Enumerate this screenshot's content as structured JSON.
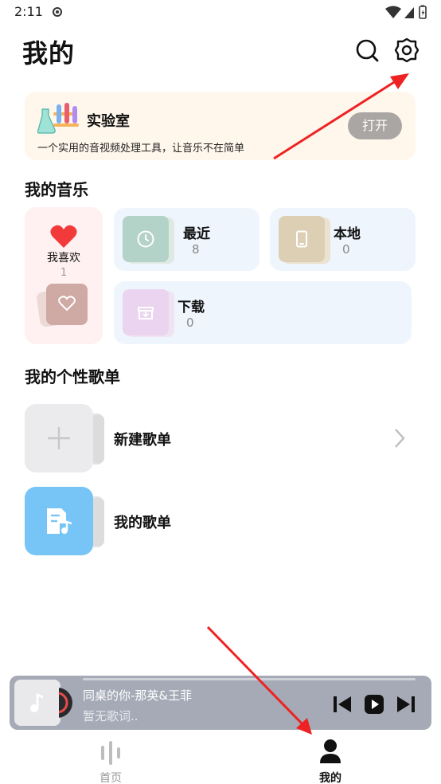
{
  "status_bar": {
    "time": "2:11"
  },
  "header": {
    "title": "我的"
  },
  "lab": {
    "title": "实验室",
    "description": "一个实用的音视频处理工具，让音乐不在简单",
    "open_label": "打开"
  },
  "my_music": {
    "title": "我的音乐",
    "favorites": {
      "label": "我喜欢",
      "count": "1"
    },
    "recent": {
      "label": "最近",
      "count": "8"
    },
    "local": {
      "label": "本地",
      "count": "0"
    },
    "downloads": {
      "label": "下载",
      "count": "0"
    }
  },
  "playlists": {
    "title": "我的个性歌单",
    "items": [
      {
        "label": "新建歌单"
      },
      {
        "label": "我的歌单"
      }
    ]
  },
  "player": {
    "song": "同桌的你-那英&王菲",
    "lyric": "暂无歌词.."
  },
  "bottom_nav": {
    "items": [
      {
        "label": "首页"
      },
      {
        "label": "我的"
      }
    ]
  },
  "colors": {
    "accent_red": "#f23a3a",
    "lab_bg": "#fff7ec",
    "card_bg": "#eef5fd",
    "player_bg": "#a5aab6",
    "annotation_arrow": "#ee2222"
  }
}
